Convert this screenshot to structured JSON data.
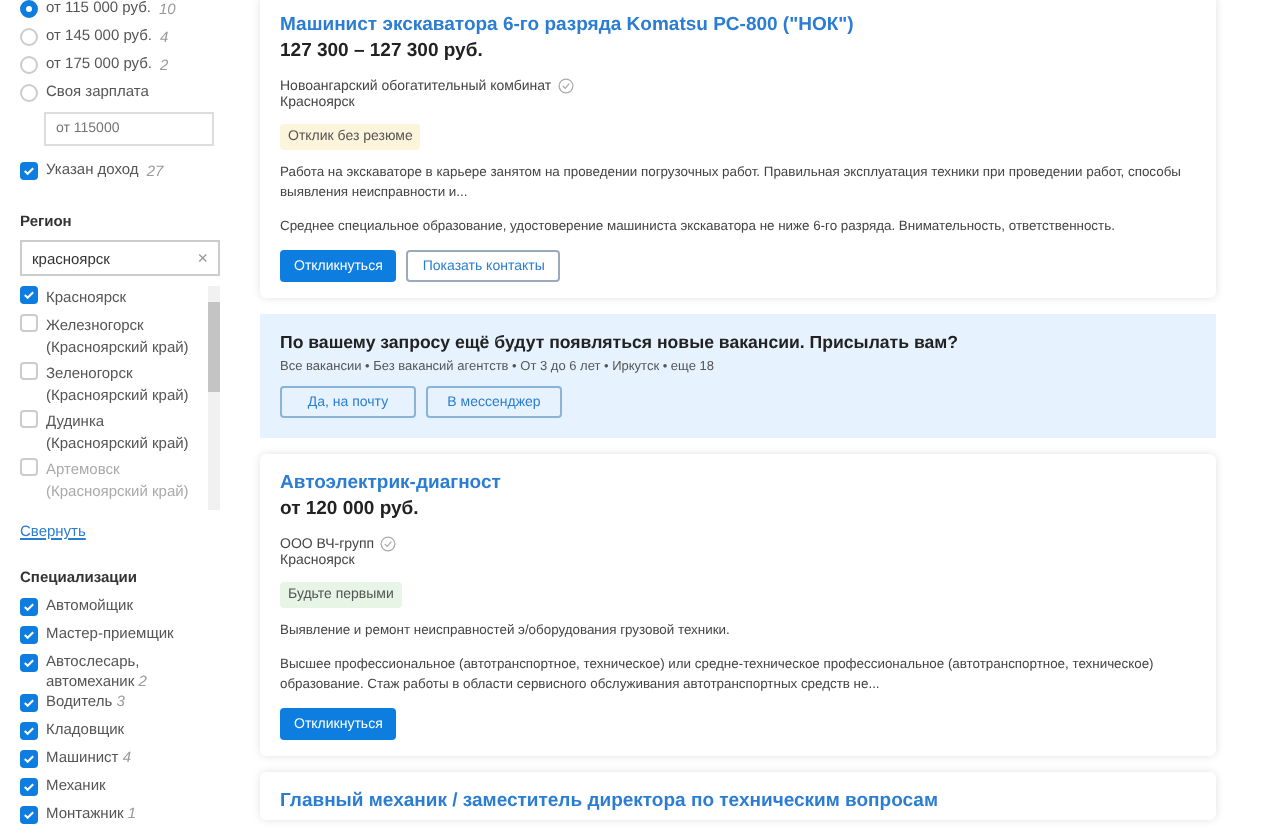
{
  "salary_filter": {
    "options": [
      {
        "label": "от 115 000 руб.",
        "count": "10",
        "selected": true
      },
      {
        "label": "от 145 000 руб.",
        "count": "4",
        "selected": false
      },
      {
        "label": "от 175 000 руб.",
        "count": "2",
        "selected": false
      },
      {
        "label": "Своя зарплата",
        "selected": false
      }
    ],
    "custom_placeholder": "от 115000",
    "income_checkbox": {
      "label": "Указан доход",
      "count": "27",
      "checked": true
    }
  },
  "region": {
    "heading": "Регион",
    "search_value": "красноярск",
    "clear": "×",
    "items": [
      {
        "label": "Красноярск",
        "checked": true
      },
      {
        "label": "Железногорск (Красноярский край)",
        "checked": false
      },
      {
        "label": "Зеленогорск (Красноярский край)",
        "checked": false
      },
      {
        "label": "Дудинка (Красноярский край)",
        "checked": false
      },
      {
        "label": "Артемовск (Красноярский край)",
        "checked": false
      }
    ],
    "collapse_link": "Свернуть"
  },
  "specializations": {
    "heading": "Специализации",
    "items": [
      {
        "label": "Автомойщик",
        "checked": true
      },
      {
        "label": "Мастер-приемщик",
        "checked": true
      },
      {
        "label": "Автослесарь, автомеханик",
        "count": "2",
        "checked": true
      },
      {
        "label": "Водитель",
        "count": "3",
        "checked": true
      },
      {
        "label": "Кладовщик",
        "checked": true
      },
      {
        "label": "Машинист",
        "count": "4",
        "checked": true
      },
      {
        "label": "Механик",
        "checked": true
      },
      {
        "label": "Монтажник",
        "count": "1",
        "checked": true
      }
    ]
  },
  "vacancies": [
    {
      "title": "Машинист экскаватора 6-го разряда Komatsu PC-800 (\"НОК\")",
      "salary": "127 300 – 127 300 руб.",
      "company": "Новоангарский обогатительный комбинат",
      "verified": true,
      "city": "Красноярск",
      "badge": {
        "text": "Отклик без резюме",
        "kind": "warning"
      },
      "description": "Работа на экскаваторе в карьере занятом на проведении погрузочных работ. Правильная эксплуатация техники при проведении работ, способы выявления неисправности и...",
      "requirements": "Среднее специальное образование, удостоверение машиниста экскаватора не ниже 6-го разряда. Внимательность, ответственность.",
      "buttons": [
        {
          "label": "Откликнуться",
          "kind": "primary"
        },
        {
          "label": "Показать контакты",
          "kind": "outline"
        }
      ]
    },
    {
      "title": "Автоэлектрик-диагност",
      "salary": "от 120 000 руб.",
      "company": "ООО ВЧ-групп",
      "verified": true,
      "city": "Красноярск",
      "badge": {
        "text": "Будьте первыми",
        "kind": "success"
      },
      "description": "Выявление и ремонт неисправностей э/оборудования грузовой техники.",
      "requirements": "Высшее профессиональное (автотранспортное, техническое) или средне-техническое профессиональное (автотранспортное, техническое) образование. Стаж работы в области сервисного обслуживания автотранспортных средств не...",
      "buttons": [
        {
          "label": "Откликнуться",
          "kind": "primary"
        }
      ]
    }
  ],
  "subscription": {
    "title": "По вашему запросу ещё будут появляться новые вакансии. Присылать вам?",
    "filters": "Все вакансии • Без вакансий агентств • От 3 до 6 лет • Иркутск • еще 18",
    "buttons": [
      "Да, на почту",
      "В мессенджер"
    ]
  },
  "next_vacancy_title": "Главный механик / заместитель директора по техническим вопросам"
}
